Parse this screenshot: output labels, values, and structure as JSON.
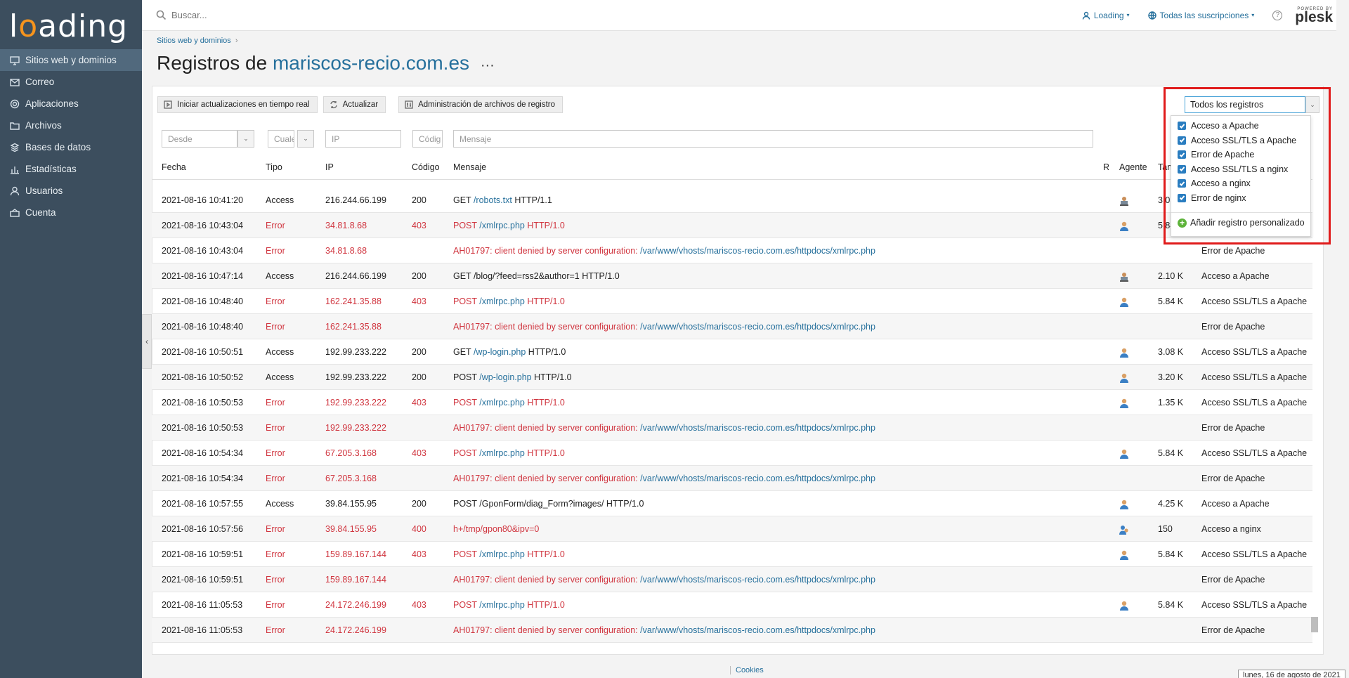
{
  "app": {
    "logo_text": "loading"
  },
  "sidebar": {
    "items": [
      {
        "label": "Sitios web y dominios",
        "icon": "monitor-icon",
        "active": true
      },
      {
        "label": "Correo",
        "icon": "mail-icon"
      },
      {
        "label": "Aplicaciones",
        "icon": "gear-icon"
      },
      {
        "label": "Archivos",
        "icon": "folder-icon"
      },
      {
        "label": "Bases de datos",
        "icon": "database-icon"
      },
      {
        "label": "Estadísticas",
        "icon": "chart-icon"
      },
      {
        "label": "Usuarios",
        "icon": "user-icon"
      },
      {
        "label": "Cuenta",
        "icon": "account-icon"
      }
    ]
  },
  "topbar": {
    "search_placeholder": "Buscar...",
    "user": "Loading",
    "subscriptions": "Todas las suscripciones",
    "help": "?",
    "powered_by": "POWERED BY",
    "brand": "plesk"
  },
  "header": {
    "breadcrumb": "Sitios web y dominios",
    "breadcrumb_sep": "›",
    "title_prefix": "Registros de",
    "title_domain": "mariscos-recio.com.es",
    "more": "···"
  },
  "toolbar": {
    "realtime": "Iniciar actualizaciones en tiempo real",
    "refresh": "Actualizar",
    "manage": "Administración de archivos de registro"
  },
  "log_select": {
    "value": "Todos los registros"
  },
  "filters": {
    "from": "Desde",
    "type": "Cuale",
    "ip": "IP",
    "code": "Códig",
    "message": "Mensaje"
  },
  "columns": {
    "fecha": "Fecha",
    "tipo": "Tipo",
    "ip": "IP",
    "codigo": "Código",
    "mensaje": "Mensaje",
    "r": "R",
    "agente": "Agente",
    "tamano": "Tam"
  },
  "dropdown": {
    "options": [
      {
        "label": "Acceso a Apache",
        "checked": true
      },
      {
        "label": "Acceso SSL/TLS a Apache",
        "checked": true
      },
      {
        "label": "Error de Apache",
        "checked": true
      },
      {
        "label": "Acceso SSL/TLS a nginx",
        "checked": true
      },
      {
        "label": "Acceso a nginx",
        "checked": true
      },
      {
        "label": "Error de nginx",
        "checked": true
      }
    ],
    "add_label": "Añadir registro personalizado"
  },
  "rows": [
    {
      "fecha": "2021-08-16 10:41:20",
      "tipo": "Access",
      "ip": "216.244.66.199",
      "codigo": "200",
      "msg_pre": "GET ",
      "msg_link": "/robots.txt",
      "msg_post": " HTTP/1.1",
      "err": false,
      "agent": "bot",
      "size": "3.08 K",
      "log": "Acceso a Apache"
    },
    {
      "fecha": "2021-08-16 10:43:04",
      "tipo": "Error",
      "ip": "34.81.8.68",
      "codigo": "403",
      "msg_pre": "POST ",
      "msg_link": "/xmlrpc.php",
      "msg_post": " HTTP/1.0",
      "err": true,
      "agent": "user",
      "size": "5.84 K",
      "log": "Acceso SSL/TLS a Apache"
    },
    {
      "fecha": "2021-08-16 10:43:04",
      "tipo": "Error",
      "ip": "34.81.8.68",
      "codigo": "",
      "msg_pre": "AH01797: client denied by server configuration: ",
      "msg_link": "/var/www/vhosts/mariscos-recio.com.es/httpdocs/xmlrpc.php",
      "msg_post": "",
      "err": true,
      "agent": "",
      "size": "",
      "log": "Error de Apache"
    },
    {
      "fecha": "2021-08-16 10:47:14",
      "tipo": "Access",
      "ip": "216.244.66.199",
      "codigo": "200",
      "msg_pre": "GET /blog/?feed=rss2&author=1 HTTP/1.0",
      "msg_link": "",
      "msg_post": "",
      "err": false,
      "agent": "bot",
      "size": "2.10 K",
      "log": "Acceso a Apache"
    },
    {
      "fecha": "2021-08-16 10:48:40",
      "tipo": "Error",
      "ip": "162.241.35.88",
      "codigo": "403",
      "msg_pre": "POST ",
      "msg_link": "/xmlrpc.php",
      "msg_post": " HTTP/1.0",
      "err": true,
      "agent": "user",
      "size": "5.84 K",
      "log": "Acceso SSL/TLS a Apache"
    },
    {
      "fecha": "2021-08-16 10:48:40",
      "tipo": "Error",
      "ip": "162.241.35.88",
      "codigo": "",
      "msg_pre": "AH01797: client denied by server configuration: ",
      "msg_link": "/var/www/vhosts/mariscos-recio.com.es/httpdocs/xmlrpc.php",
      "msg_post": "",
      "err": true,
      "agent": "",
      "size": "",
      "log": "Error de Apache"
    },
    {
      "fecha": "2021-08-16 10:50:51",
      "tipo": "Access",
      "ip": "192.99.233.222",
      "codigo": "200",
      "msg_pre": "GET ",
      "msg_link": "/wp-login.php",
      "msg_post": " HTTP/1.0",
      "err": false,
      "agent": "user",
      "size": "3.08 K",
      "log": "Acceso SSL/TLS a Apache"
    },
    {
      "fecha": "2021-08-16 10:50:52",
      "tipo": "Access",
      "ip": "192.99.233.222",
      "codigo": "200",
      "msg_pre": "POST ",
      "msg_link": "/wp-login.php",
      "msg_post": " HTTP/1.0",
      "err": false,
      "agent": "user",
      "size": "3.20 K",
      "log": "Acceso SSL/TLS a Apache"
    },
    {
      "fecha": "2021-08-16 10:50:53",
      "tipo": "Error",
      "ip": "192.99.233.222",
      "codigo": "403",
      "msg_pre": "POST ",
      "msg_link": "/xmlrpc.php",
      "msg_post": " HTTP/1.0",
      "err": true,
      "agent": "user",
      "size": "1.35 K",
      "log": "Acceso SSL/TLS a Apache"
    },
    {
      "fecha": "2021-08-16 10:50:53",
      "tipo": "Error",
      "ip": "192.99.233.222",
      "codigo": "",
      "msg_pre": "AH01797: client denied by server configuration: ",
      "msg_link": "/var/www/vhosts/mariscos-recio.com.es/httpdocs/xmlrpc.php",
      "msg_post": "",
      "err": true,
      "agent": "",
      "size": "",
      "log": "Error de Apache"
    },
    {
      "fecha": "2021-08-16 10:54:34",
      "tipo": "Error",
      "ip": "67.205.3.168",
      "codigo": "403",
      "msg_pre": "POST ",
      "msg_link": "/xmlrpc.php",
      "msg_post": " HTTP/1.0",
      "err": true,
      "agent": "user",
      "size": "5.84 K",
      "log": "Acceso SSL/TLS a Apache"
    },
    {
      "fecha": "2021-08-16 10:54:34",
      "tipo": "Error",
      "ip": "67.205.3.168",
      "codigo": "",
      "msg_pre": "AH01797: client denied by server configuration: ",
      "msg_link": "/var/www/vhosts/mariscos-recio.com.es/httpdocs/xmlrpc.php",
      "msg_post": "",
      "err": true,
      "agent": "",
      "size": "",
      "log": "Error de Apache"
    },
    {
      "fecha": "2021-08-16 10:57:55",
      "tipo": "Access",
      "ip": "39.84.155.95",
      "codigo": "200",
      "msg_pre": "POST /GponForm/diag_Form?images/ HTTP/1.0",
      "msg_link": "",
      "msg_post": "",
      "err": false,
      "agent": "user",
      "size": "4.25 K",
      "log": "Acceso a Apache"
    },
    {
      "fecha": "2021-08-16 10:57:56",
      "tipo": "Error",
      "ip": "39.84.155.95",
      "codigo": "400",
      "msg_pre": "h+/tmp/gpon80&ipv=0",
      "msg_link": "",
      "msg_post": "",
      "err": true,
      "agent": "group",
      "size": "150",
      "log": "Acceso a nginx"
    },
    {
      "fecha": "2021-08-16 10:59:51",
      "tipo": "Error",
      "ip": "159.89.167.144",
      "codigo": "403",
      "msg_pre": "POST ",
      "msg_link": "/xmlrpc.php",
      "msg_post": " HTTP/1.0",
      "err": true,
      "agent": "user",
      "size": "5.84 K",
      "log": "Acceso SSL/TLS a Apache"
    },
    {
      "fecha": "2021-08-16 10:59:51",
      "tipo": "Error",
      "ip": "159.89.167.144",
      "codigo": "",
      "msg_pre": "AH01797: client denied by server configuration: ",
      "msg_link": "/var/www/vhosts/mariscos-recio.com.es/httpdocs/xmlrpc.php",
      "msg_post": "",
      "err": true,
      "agent": "",
      "size": "",
      "log": "Error de Apache"
    },
    {
      "fecha": "2021-08-16 11:05:53",
      "tipo": "Error",
      "ip": "24.172.246.199",
      "codigo": "403",
      "msg_pre": "POST ",
      "msg_link": "/xmlrpc.php",
      "msg_post": " HTTP/1.0",
      "err": true,
      "agent": "user",
      "size": "5.84 K",
      "log": "Acceso SSL/TLS a Apache"
    },
    {
      "fecha": "2021-08-16 11:05:53",
      "tipo": "Error",
      "ip": "24.172.246.199",
      "codigo": "",
      "msg_pre": "AH01797: client denied by server configuration: ",
      "msg_link": "/var/www/vhosts/mariscos-recio.com.es/httpdocs/xmlrpc.php",
      "msg_post": "",
      "err": true,
      "agent": "",
      "size": "",
      "log": "Error de Apache"
    }
  ],
  "footer": {
    "cookies": "Cookies",
    "date": "lunes, 16 de agosto de 2021"
  },
  "colors": {
    "sidebar": "#3c4e5e",
    "link": "#26709c",
    "error": "#d0353f",
    "highlight": "#e01b1b",
    "accent": "#f7941d"
  }
}
